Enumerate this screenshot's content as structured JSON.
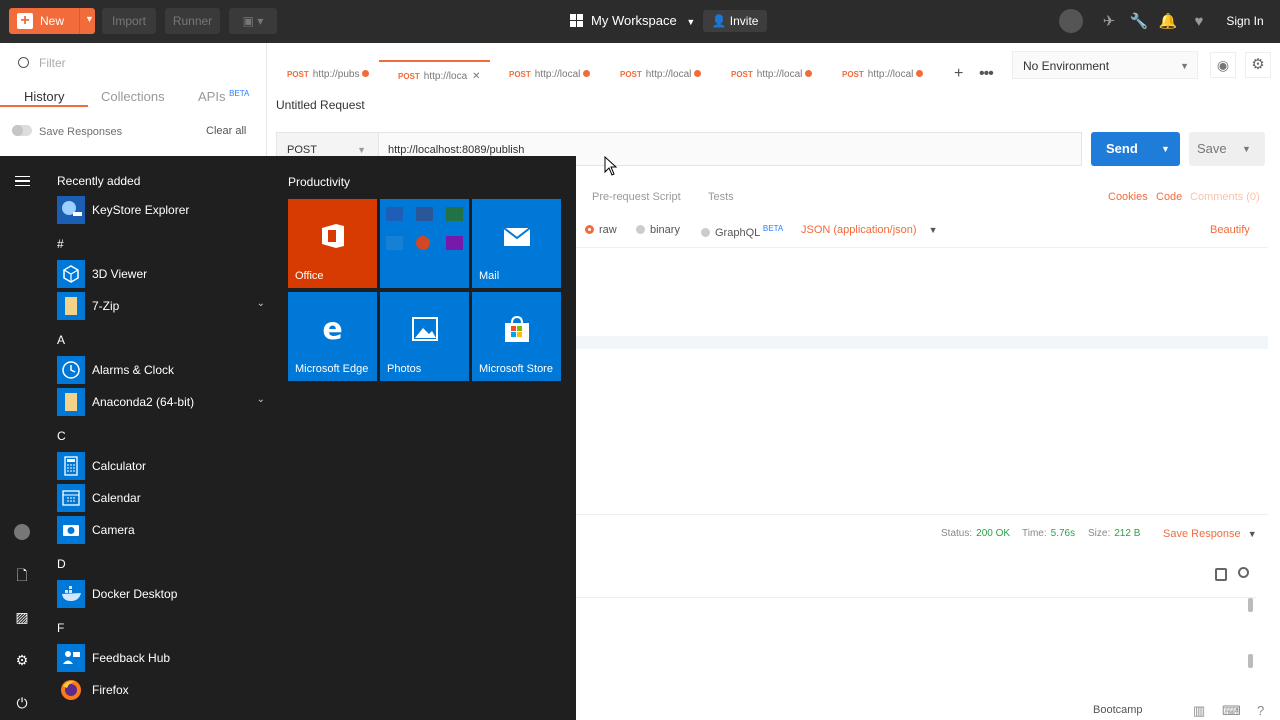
{
  "topbar": {
    "new_label": "New",
    "import_label": "Import",
    "runner_label": "Runner",
    "workspace": "My Workspace",
    "invite": "Invite",
    "signin": "Sign In"
  },
  "sidebar": {
    "filter_placeholder": "Filter",
    "tabs": {
      "history": "History",
      "collections": "Collections",
      "apis": "APIs",
      "apis_badge": "BETA"
    },
    "save_responses": "Save Responses",
    "clear_all": "Clear all"
  },
  "request_tabs": [
    {
      "method": "POST",
      "url": "http://pubs"
    },
    {
      "method": "POST",
      "url": "http://loca"
    },
    {
      "method": "POST",
      "url": "http://local"
    },
    {
      "method": "POST",
      "url": "http://local"
    },
    {
      "method": "POST",
      "url": "http://local"
    },
    {
      "method": "POST",
      "url": "http://local"
    }
  ],
  "environment": "No Environment",
  "request": {
    "title": "Untitled Request",
    "method": "POST",
    "url": "http://localhost:8089/publish",
    "send": "Send",
    "save": "Save",
    "tab_prerequest": "Pre-request Script",
    "tab_tests": "Tests",
    "cookies": "Cookies",
    "code": "Code",
    "comments": "Comments (0)",
    "body_raw": "raw",
    "body_binary": "binary",
    "body_graphql": "GraphQL",
    "graphql_badge": "BETA",
    "content_type": "JSON (application/json)",
    "beautify": "Beautify"
  },
  "response": {
    "status_label": "Status:",
    "status_value": "200 OK",
    "time_label": "Time:",
    "time_value": "5.76s",
    "size_label": "Size:",
    "size_value": "212 B",
    "save_response": "Save Response"
  },
  "footer": {
    "bootcamp": "Bootcamp"
  },
  "start_menu": {
    "recently_added": "Recently added",
    "productivity": "Productivity",
    "apps": [
      {
        "name": "KeyStore Explorer",
        "expandable": false
      },
      {
        "name": "3D Viewer",
        "expandable": false
      },
      {
        "name": "7-Zip",
        "expandable": true
      },
      {
        "name": "Alarms & Clock",
        "expandable": false
      },
      {
        "name": "Anaconda2 (64-bit)",
        "expandable": true
      },
      {
        "name": "Calculator",
        "expandable": false
      },
      {
        "name": "Calendar",
        "expandable": false
      },
      {
        "name": "Camera",
        "expandable": false
      },
      {
        "name": "Docker Desktop",
        "expandable": false
      },
      {
        "name": "Feedback Hub",
        "expandable": false
      },
      {
        "name": "Firefox",
        "expandable": false
      }
    ],
    "letters": [
      "#",
      "A",
      "C",
      "D",
      "F"
    ],
    "tiles": [
      {
        "label": "Office",
        "color": "#d83b01"
      },
      {
        "label": "",
        "color": "#0078d7"
      },
      {
        "label": "Mail",
        "color": "#0078d7"
      },
      {
        "label": "Microsoft Edge",
        "color": "#0078d7"
      },
      {
        "label": "Photos",
        "color": "#0078d7"
      },
      {
        "label": "Microsoft Store",
        "color": "#0078d7"
      }
    ]
  },
  "colors": {
    "accent": "#f26b3a",
    "send": "#1f7cd8",
    "ok": "#2aa34a",
    "tile": "#0078d7"
  }
}
